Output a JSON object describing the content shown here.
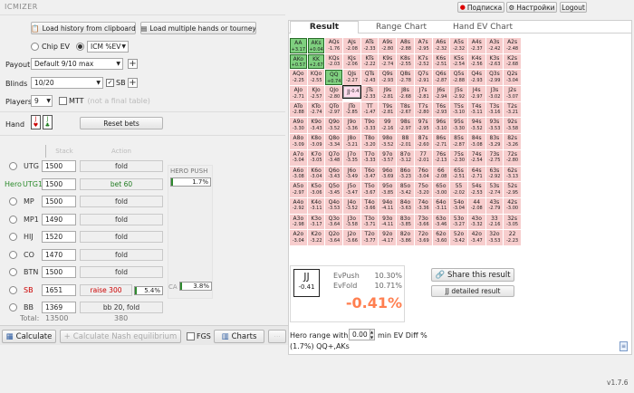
{
  "app": {
    "logo": "ICMIZER",
    "version": "v1.7.6"
  },
  "topbar": {
    "subscribe": "Подписка",
    "settings": "Настройки",
    "logout": "Logout"
  },
  "toolbar": {
    "load_history": "Load history from clipboard",
    "load_multiple": "Load multiple hands or tourney"
  },
  "mode": {
    "chip_ev": "Chip EV",
    "icm": "ICM %EV"
  },
  "form": {
    "payout_label": "Payout",
    "payout_value": "Default 9/10 max",
    "blinds_label": "Blinds",
    "blinds_value": "10/20",
    "sb_label": "SB",
    "players_label": "Players",
    "players_value": "9",
    "mtt_label": "MTT",
    "mtt_hint": "(not a final table)",
    "hand_label": "Hand",
    "reset_bets": "Reset bets",
    "stack_header": "Stack",
    "action_header": "Action",
    "hero_push_header": "HERO PUSH",
    "hero_push_value": "1.7%",
    "hero_push_fill": 0.017,
    "ca_label": "CA",
    "ca_value": "3.8%",
    "ca_fill": 0.038,
    "total_label": "Total:",
    "total_stack": "13500",
    "total_action": "380"
  },
  "players": [
    {
      "pos": "UTG",
      "stack": "1500",
      "action": "fold",
      "hero": false,
      "sb": false
    },
    {
      "pos": "UTG1",
      "stack": "1500",
      "action": "bet 60",
      "hero": true,
      "sb": false
    },
    {
      "pos": "MP",
      "stack": "1500",
      "action": "fold",
      "hero": false,
      "sb": false
    },
    {
      "pos": "MP1",
      "stack": "1490",
      "action": "fold",
      "hero": false,
      "sb": false
    },
    {
      "pos": "HIJ",
      "stack": "1520",
      "action": "fold",
      "hero": false,
      "sb": false
    },
    {
      "pos": "CO",
      "stack": "1470",
      "action": "fold",
      "hero": false,
      "sb": false
    },
    {
      "pos": "BTN",
      "stack": "1500",
      "action": "fold",
      "hero": false,
      "sb": false
    },
    {
      "pos": "SB",
      "stack": "1651",
      "action": "raise 300",
      "hero": false,
      "sb": true,
      "pct": "5.4%",
      "fill": 0.054
    },
    {
      "pos": "BB",
      "stack": "1369",
      "action": "bb 20, fold",
      "hero": false,
      "sb": false
    }
  ],
  "hero_label": "Hero",
  "bottom": {
    "calculate": "Calculate",
    "nash": "Calculate Nash equilibrium",
    "fgs": "FGS",
    "charts": "Charts"
  },
  "tabs": [
    "Result",
    "Range Chart",
    "Hand EV Chart"
  ],
  "result": {
    "hand": "JJ",
    "hand_ev": "-0.41",
    "evpush_label": "EvPush",
    "evpush_value": "10.30%",
    "evfold_label": "EvFold",
    "evfold_value": "10.71%",
    "diff": "-0.41%",
    "share": "Share this result",
    "detailed": "JJ detailed result",
    "range_label": "Hero range with",
    "range_input": "0.00",
    "range_suffix": "min EV Diff %",
    "range_text": "(1.7%) QQ+,AKs"
  },
  "range_grid": [
    [
      [
        "AA",
        "+3.17"
      ],
      [
        "AKs",
        "+0.04"
      ],
      [
        "AQs",
        "-1.76"
      ],
      [
        "AJs",
        "-2.08"
      ],
      [
        "ATs",
        "-2.33"
      ],
      [
        "A9s",
        "-2.80"
      ],
      [
        "A8s",
        "-2.88"
      ],
      [
        "A7s",
        "-2.95"
      ],
      [
        "A6s",
        "-2.32"
      ],
      [
        "A5s",
        "-2.32"
      ],
      [
        "A4s",
        "-2.37"
      ],
      [
        "A3s",
        "-2.42"
      ],
      [
        "A2s",
        "-2.48"
      ]
    ],
    [
      [
        "AKo",
        "+0.57"
      ],
      [
        "KK",
        "+2.67"
      ],
      [
        "KQs",
        "-2.03"
      ],
      [
        "KJs",
        "-2.06"
      ],
      [
        "KTs",
        "-2.22"
      ],
      [
        "K9s",
        "-2.74"
      ],
      [
        "K8s",
        "-2.55"
      ],
      [
        "K7s",
        "-2.52"
      ],
      [
        "K6s",
        "-2.51"
      ],
      [
        "K5s",
        "-2.54"
      ],
      [
        "K4s",
        "-2.56"
      ],
      [
        "K3s",
        "-2.63"
      ],
      [
        "K2s",
        "-2.68"
      ]
    ],
    [
      [
        "AQo",
        "-2.25"
      ],
      [
        "KQo",
        "-2.55"
      ],
      [
        "QQ",
        "+0.74"
      ],
      [
        "QJs",
        "-2.27"
      ],
      [
        "QTs",
        "-2.43"
      ],
      [
        "Q9s",
        "-2.93"
      ],
      [
        "Q8s",
        "-2.78"
      ],
      [
        "Q7s",
        "-2.91"
      ],
      [
        "Q6s",
        "-2.87"
      ],
      [
        "Q5s",
        "-2.88"
      ],
      [
        "Q4s",
        "-2.93"
      ],
      [
        "Q3s",
        "-2.99"
      ],
      [
        "Q2s",
        "-3.04"
      ]
    ],
    [
      [
        "AJo",
        "-2.71"
      ],
      [
        "KJo",
        "-2.57"
      ],
      [
        "QJo",
        "-2.80"
      ],
      [
        "JJ",
        "-0.41"
      ],
      [
        "JTs",
        "-2.33"
      ],
      [
        "J9s",
        "-2.81"
      ],
      [
        "J8s",
        "-2.68"
      ],
      [
        "J7s",
        "-2.81"
      ],
      [
        "J6s",
        "-2.94"
      ],
      [
        "J5s",
        "-2.92"
      ],
      [
        "J4s",
        "-2.97"
      ],
      [
        "J3s",
        "-3.02"
      ],
      [
        "J2s",
        "-3.07"
      ]
    ],
    [
      [
        "ATo",
        "-2.88"
      ],
      [
        "KTo",
        "-2.74"
      ],
      [
        "QTo",
        "-2.97"
      ],
      [
        "JTo",
        "-2.85"
      ],
      [
        "TT",
        "-1.47"
      ],
      [
        "T9s",
        "-2.81"
      ],
      [
        "T8s",
        "-2.67"
      ],
      [
        "T7s",
        "-2.80"
      ],
      [
        "T6s",
        "-2.93"
      ],
      [
        "T5s",
        "-3.10"
      ],
      [
        "T4s",
        "-3.11"
      ],
      [
        "T3s",
        "-3.16"
      ],
      [
        "T2s",
        "-3.21"
      ]
    ],
    [
      [
        "A9o",
        "-3.30"
      ],
      [
        "K9o",
        "-3.43"
      ],
      [
        "Q9o",
        "-3.52"
      ],
      [
        "J9o",
        "-3.36"
      ],
      [
        "T9o",
        "-3.33"
      ],
      [
        "99",
        "-2.16"
      ],
      [
        "98s",
        "-2.97"
      ],
      [
        "97s",
        "-2.95"
      ],
      [
        "96s",
        "-3.10"
      ],
      [
        "95s",
        "-3.30"
      ],
      [
        "94s",
        "-3.52"
      ],
      [
        "93s",
        "-3.53"
      ],
      [
        "92s",
        "-3.58"
      ]
    ],
    [
      [
        "A8o",
        "-3.09"
      ],
      [
        "K8o",
        "-3.09"
      ],
      [
        "Q8o",
        "-3.34"
      ],
      [
        "J8o",
        "-3.21"
      ],
      [
        "T8o",
        "-3.20"
      ],
      [
        "98o",
        "-3.52"
      ],
      [
        "88",
        "-2.01"
      ],
      [
        "87s",
        "-2.60"
      ],
      [
        "86s",
        "-2.71"
      ],
      [
        "85s",
        "-2.87"
      ],
      [
        "84s",
        "-3.08"
      ],
      [
        "83s",
        "-3.29"
      ],
      [
        "82s",
        "-3.26"
      ]
    ],
    [
      [
        "A7o",
        "-3.04"
      ],
      [
        "K7o",
        "-3.05"
      ],
      [
        "Q7o",
        "-3.48"
      ],
      [
        "J7o",
        "-3.35"
      ],
      [
        "T7o",
        "-3.33"
      ],
      [
        "97o",
        "-3.57"
      ],
      [
        "87o",
        "-3.12"
      ],
      [
        "77",
        "-2.01"
      ],
      [
        "76s",
        "-2.13"
      ],
      [
        "75s",
        "-2.30"
      ],
      [
        "74s",
        "-2.54"
      ],
      [
        "73s",
        "-2.75"
      ],
      [
        "72s",
        "-2.80"
      ]
    ],
    [
      [
        "A6o",
        "-3.08"
      ],
      [
        "K6o",
        "-3.04"
      ],
      [
        "Q6o",
        "-3.43"
      ],
      [
        "J6o",
        "-3.49"
      ],
      [
        "T6o",
        "-3.47"
      ],
      [
        "96o",
        "-3.69"
      ],
      [
        "86o",
        "-3.23"
      ],
      [
        "76o",
        "-3.04"
      ],
      [
        "66",
        "-2.08"
      ],
      [
        "65s",
        "-2.51"
      ],
      [
        "64s",
        "-2.71"
      ],
      [
        "63s",
        "-2.92"
      ],
      [
        "62s",
        "-3.13"
      ]
    ],
    [
      [
        "A5o",
        "-2.97"
      ],
      [
        "K5o",
        "-3.06"
      ],
      [
        "Q5o",
        "-3.45"
      ],
      [
        "J5o",
        "-3.47"
      ],
      [
        "T5o",
        "-3.67"
      ],
      [
        "95o",
        "-3.85"
      ],
      [
        "85o",
        "-3.42"
      ],
      [
        "75o",
        "-3.20"
      ],
      [
        "65o",
        "-3.00"
      ],
      [
        "55",
        "-2.02"
      ],
      [
        "54s",
        "-2.53"
      ],
      [
        "53s",
        "-2.74"
      ],
      [
        "52s",
        "-2.95"
      ]
    ],
    [
      [
        "A4o",
        "-2.92"
      ],
      [
        "K4o",
        "-3.11"
      ],
      [
        "Q4o",
        "-3.53"
      ],
      [
        "J4o",
        "-3.52"
      ],
      [
        "T4o",
        "-3.66"
      ],
      [
        "94o",
        "-4.11"
      ],
      [
        "84o",
        "-3.63"
      ],
      [
        "74o",
        "-3.36"
      ],
      [
        "64o",
        "-3.11"
      ],
      [
        "54o",
        "-3.04"
      ],
      [
        "44",
        "-2.08"
      ],
      [
        "43s",
        "-2.79"
      ],
      [
        "42s",
        "-3.00"
      ]
    ],
    [
      [
        "A3o",
        "-2.98"
      ],
      [
        "K3o",
        "-3.17"
      ],
      [
        "Q3o",
        "-3.64"
      ],
      [
        "J3o",
        "-3.58"
      ],
      [
        "T3o",
        "-3.71"
      ],
      [
        "93o",
        "-4.11"
      ],
      [
        "83o",
        "-3.85"
      ],
      [
        "73o",
        "-3.66"
      ],
      [
        "63o",
        "-3.46"
      ],
      [
        "53o",
        "-3.27"
      ],
      [
        "43o",
        "-3.32"
      ],
      [
        "33",
        "-2.16"
      ],
      [
        "32s",
        "-3.05"
      ]
    ],
    [
      [
        "A2o",
        "-3.04"
      ],
      [
        "K2o",
        "-3.22"
      ],
      [
        "Q2o",
        "-3.64"
      ],
      [
        "J2o",
        "-3.66"
      ],
      [
        "T2o",
        "-3.77"
      ],
      [
        "92o",
        "-4.17"
      ],
      [
        "82o",
        "-3.86"
      ],
      [
        "72o",
        "-3.69"
      ],
      [
        "62o",
        "-3.60"
      ],
      [
        "52o",
        "-3.42"
      ],
      [
        "42o",
        "-3.47"
      ],
      [
        "32o",
        "-3.53"
      ],
      [
        "22",
        "-2.23"
      ]
    ]
  ]
}
